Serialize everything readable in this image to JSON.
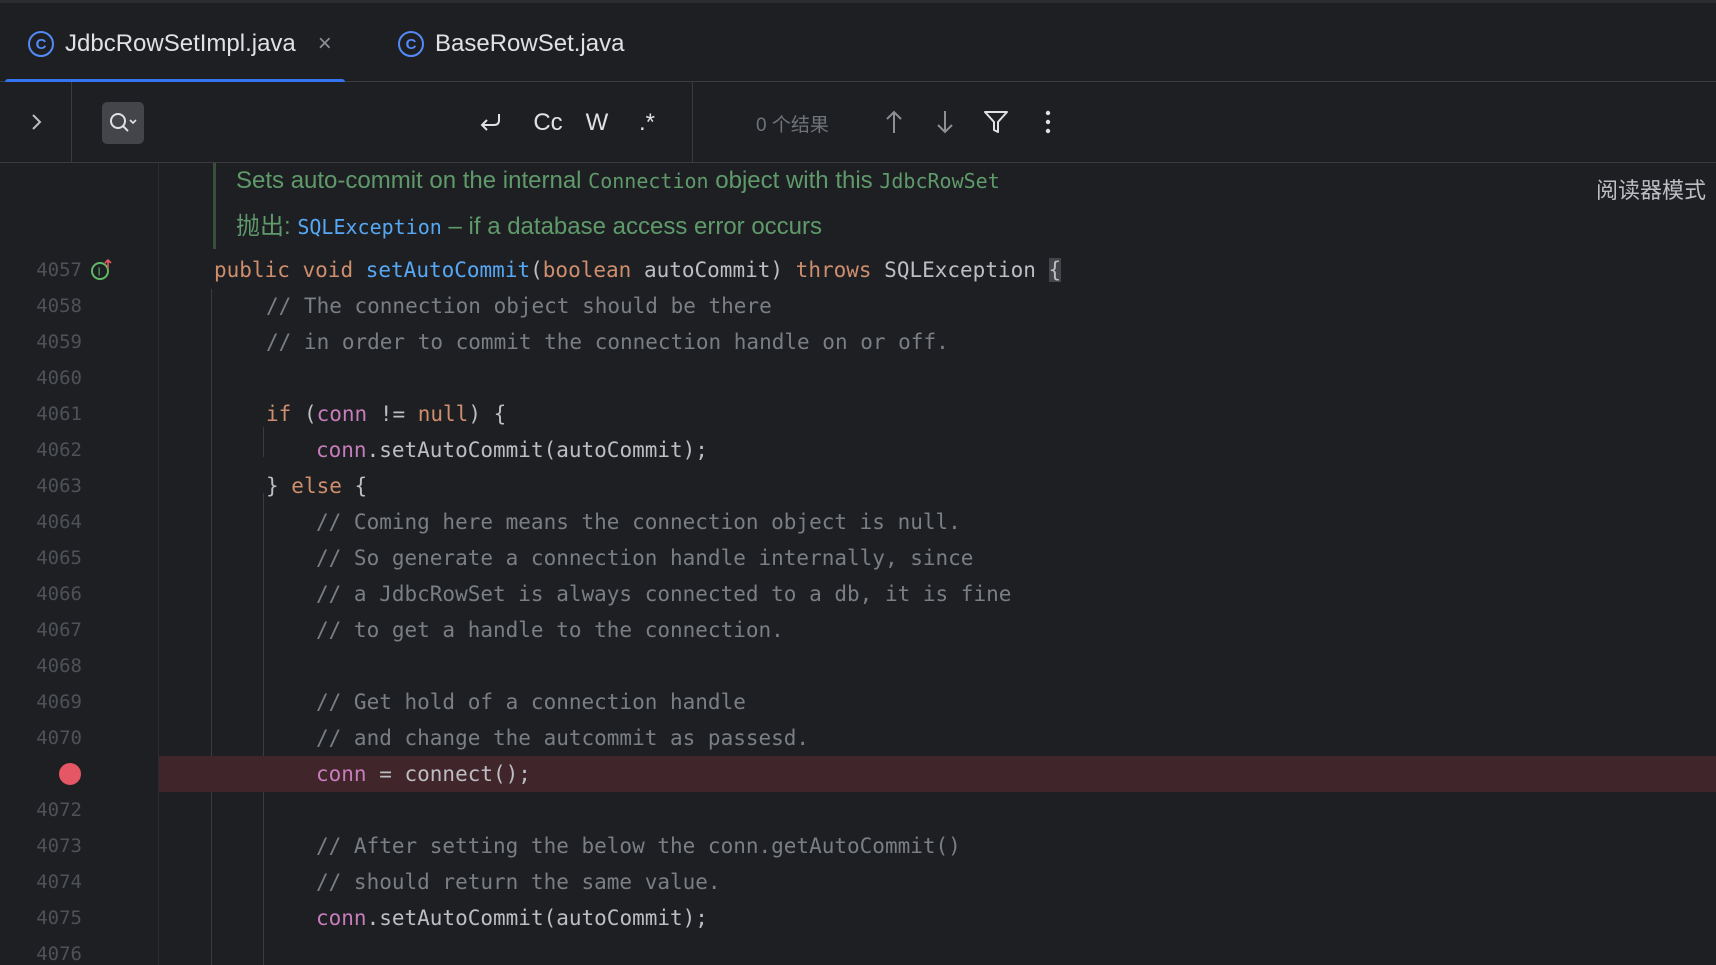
{
  "tabs": [
    {
      "label": "JdbcRowSetImpl.java",
      "active": true,
      "closable": true,
      "icon": "class-icon"
    },
    {
      "label": "BaseRowSet.java",
      "active": false,
      "closable": false,
      "icon": "class-icon"
    }
  ],
  "find": {
    "case_label": "Cc",
    "word_label": "W",
    "regex_label": ".*",
    "results": "0 个结果"
  },
  "doc": {
    "line1_pre": "Sets auto-commit on the internal ",
    "line1_code1": "Connection",
    "line1_mid": " object with this ",
    "line1_code2": "JdbcRowSet",
    "line2_pre": "抛出: ",
    "line2_link": "SQLException",
    "line2_post": " – if a database access error occurs",
    "reader_mode": "阅读器模式"
  },
  "lines": [
    {
      "num": "4057"
    },
    {
      "num": "4058",
      "text": "// The connection object should be there"
    },
    {
      "num": "4059",
      "text": "// in order to commit the connection handle on or off."
    },
    {
      "num": "4060"
    },
    {
      "num": "4061"
    },
    {
      "num": "4062"
    },
    {
      "num": "4063"
    },
    {
      "num": "4064",
      "text": "// Coming here means the connection object is null."
    },
    {
      "num": "4065",
      "text": "// So generate a connection handle internally, since"
    },
    {
      "num": "4066",
      "text": "// a JdbcRowSet is always connected to a db, it is fine"
    },
    {
      "num": "4067",
      "text": "// to get a handle to the connection."
    },
    {
      "num": "4068"
    },
    {
      "num": "4069",
      "text": "// Get hold of a connection handle"
    },
    {
      "num": "4070",
      "text": "// and change the autcommit as passesd."
    },
    {
      "num": ""
    },
    {
      "num": "4072"
    },
    {
      "num": "4073",
      "text": "// After setting the below the conn.getAutoCommit()"
    },
    {
      "num": "4074",
      "text": "// should return the same value."
    },
    {
      "num": "4075"
    },
    {
      "num": "4076"
    }
  ],
  "code": {
    "sig_public": "public",
    "sig_void": "void",
    "sig_name": "setAutoCommit",
    "sig_params_open": "(",
    "sig_type": "boolean",
    "sig_param": " autoCommit) ",
    "sig_throws": "throws",
    "sig_exc": " SQLException ",
    "sig_brace": "{",
    "if_kw": "if",
    "if_open": " (",
    "if_conn": "conn",
    "if_ne": " != ",
    "if_null": "null",
    "if_close": ") {",
    "c1_conn": "conn",
    "c1_rest": ".setAutoCommit(autoCommit);",
    "else_pre": "} ",
    "else_kw": "else",
    "else_post": " {",
    "bp_conn": "conn",
    "bp_rest": " = connect();",
    "c2_conn": "conn",
    "c2_rest": ".setAutoCommit(autoCommit);"
  },
  "colors": {
    "accent": "#3574f0",
    "breakpoint": "#e55765",
    "keyword": "#cf8e6d",
    "function": "#56a8f5",
    "field": "#c77dbb",
    "comment": "#7a7e85",
    "doc": "#5f9a6b"
  }
}
